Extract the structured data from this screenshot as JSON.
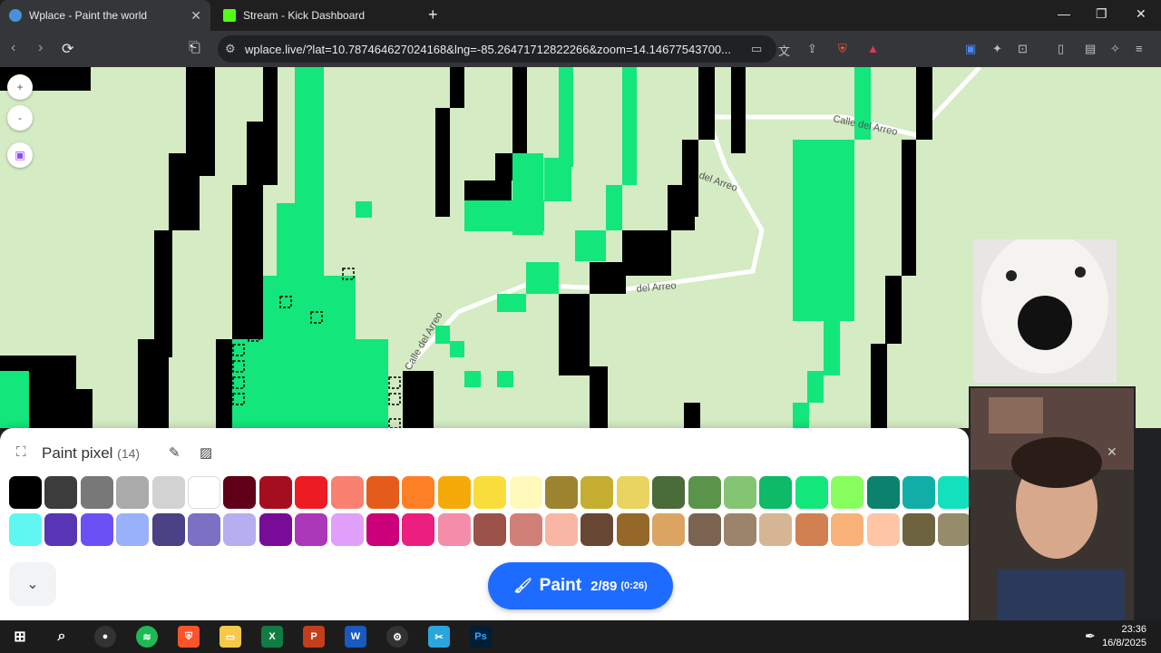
{
  "browser": {
    "tabs": [
      {
        "title": "Wplace - Paint the world",
        "active": true,
        "favicon": "globe-icon"
      },
      {
        "title": "Stream - Kick Dashboard",
        "active": false,
        "favicon": "kick-logo-icon"
      }
    ],
    "url": "wplace.live/?lat=10.787464627024168&lng=-85.26471712822266&zoom=14.14677543700..."
  },
  "map": {
    "zoom_in": "+",
    "zoom_out": "-",
    "street_labels": [
      "Calle del Arreo",
      "del Arreo",
      "del Arreo",
      "Calle del Arreo"
    ]
  },
  "panel": {
    "title": "Paint pixel",
    "count": "(14)",
    "selected_color": "#20e87a",
    "palette_row1": [
      "#000000",
      "#3c3c3c",
      "#787878",
      "#aaaaaa",
      "#d2d2d2",
      "#ffffff",
      "#600018",
      "#a50e1e",
      "#ed1c24",
      "#fa8072",
      "#e45c1a",
      "#ff7f27",
      "#f6aa09",
      "#f9dd3b",
      "#fffabc",
      "#9c8431",
      "#c5ad31",
      "#e8d45f",
      "#4a6b3a",
      "#5a944a",
      "#84c573",
      "#0eb968",
      "#13e67b",
      "#87ff5e",
      "#0c816e",
      "#10aea6",
      "#13e1be"
    ],
    "palette_row2": [
      "#60f7f2",
      "#5735b5",
      "#6b50f6",
      "#99b1fb",
      "#4a4284",
      "#7a71c4",
      "#b5aef1",
      "#780c99",
      "#aa38b9",
      "#e09ff9",
      "#cb007a",
      "#ec1f80",
      "#f38da9",
      "#9b5249",
      "#d18078",
      "#fab6a4",
      "#684634",
      "#95682a",
      "#dba463",
      "#7b6352",
      "#9c846b",
      "#d6b594",
      "#d18051",
      "#f8b277",
      "#ffc5a5",
      "#6d643f",
      "#948c6b"
    ],
    "paint_button": {
      "label": "Paint",
      "charges": "2/89",
      "timer": "(0:26)"
    }
  },
  "taskbar": {
    "time": "23:36",
    "date": "16/8/2025"
  }
}
